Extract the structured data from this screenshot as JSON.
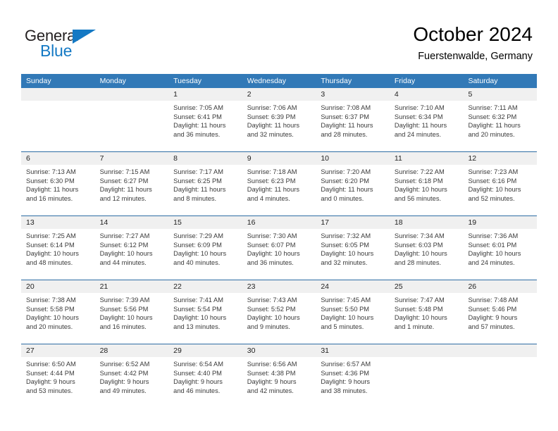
{
  "brand": {
    "name_primary": "General",
    "name_secondary": "Blue",
    "primary_color": "#231f20",
    "accent_color": "#1479c4"
  },
  "header": {
    "title": "October 2024",
    "subtitle": "Fuerstenwalde, Germany"
  },
  "theme": {
    "header_bar_color": "#3279b7",
    "week_divider_color": "#2e6da4",
    "day_band_color": "#f0f0f0",
    "text_color": "#3a3a3a"
  },
  "weekdays": [
    "Sunday",
    "Monday",
    "Tuesday",
    "Wednesday",
    "Thursday",
    "Friday",
    "Saturday"
  ],
  "weeks": [
    [
      {
        "day": "",
        "lines": []
      },
      {
        "day": "",
        "lines": []
      },
      {
        "day": "1",
        "lines": [
          "Sunrise: 7:05 AM",
          "Sunset: 6:41 PM",
          "Daylight: 11 hours",
          "and 36 minutes."
        ]
      },
      {
        "day": "2",
        "lines": [
          "Sunrise: 7:06 AM",
          "Sunset: 6:39 PM",
          "Daylight: 11 hours",
          "and 32 minutes."
        ]
      },
      {
        "day": "3",
        "lines": [
          "Sunrise: 7:08 AM",
          "Sunset: 6:37 PM",
          "Daylight: 11 hours",
          "and 28 minutes."
        ]
      },
      {
        "day": "4",
        "lines": [
          "Sunrise: 7:10 AM",
          "Sunset: 6:34 PM",
          "Daylight: 11 hours",
          "and 24 minutes."
        ]
      },
      {
        "day": "5",
        "lines": [
          "Sunrise: 7:11 AM",
          "Sunset: 6:32 PM",
          "Daylight: 11 hours",
          "and 20 minutes."
        ]
      }
    ],
    [
      {
        "day": "6",
        "lines": [
          "Sunrise: 7:13 AM",
          "Sunset: 6:30 PM",
          "Daylight: 11 hours",
          "and 16 minutes."
        ]
      },
      {
        "day": "7",
        "lines": [
          "Sunrise: 7:15 AM",
          "Sunset: 6:27 PM",
          "Daylight: 11 hours",
          "and 12 minutes."
        ]
      },
      {
        "day": "8",
        "lines": [
          "Sunrise: 7:17 AM",
          "Sunset: 6:25 PM",
          "Daylight: 11 hours",
          "and 8 minutes."
        ]
      },
      {
        "day": "9",
        "lines": [
          "Sunrise: 7:18 AM",
          "Sunset: 6:23 PM",
          "Daylight: 11 hours",
          "and 4 minutes."
        ]
      },
      {
        "day": "10",
        "lines": [
          "Sunrise: 7:20 AM",
          "Sunset: 6:20 PM",
          "Daylight: 11 hours",
          "and 0 minutes."
        ]
      },
      {
        "day": "11",
        "lines": [
          "Sunrise: 7:22 AM",
          "Sunset: 6:18 PM",
          "Daylight: 10 hours",
          "and 56 minutes."
        ]
      },
      {
        "day": "12",
        "lines": [
          "Sunrise: 7:23 AM",
          "Sunset: 6:16 PM",
          "Daylight: 10 hours",
          "and 52 minutes."
        ]
      }
    ],
    [
      {
        "day": "13",
        "lines": [
          "Sunrise: 7:25 AM",
          "Sunset: 6:14 PM",
          "Daylight: 10 hours",
          "and 48 minutes."
        ]
      },
      {
        "day": "14",
        "lines": [
          "Sunrise: 7:27 AM",
          "Sunset: 6:12 PM",
          "Daylight: 10 hours",
          "and 44 minutes."
        ]
      },
      {
        "day": "15",
        "lines": [
          "Sunrise: 7:29 AM",
          "Sunset: 6:09 PM",
          "Daylight: 10 hours",
          "and 40 minutes."
        ]
      },
      {
        "day": "16",
        "lines": [
          "Sunrise: 7:30 AM",
          "Sunset: 6:07 PM",
          "Daylight: 10 hours",
          "and 36 minutes."
        ]
      },
      {
        "day": "17",
        "lines": [
          "Sunrise: 7:32 AM",
          "Sunset: 6:05 PM",
          "Daylight: 10 hours",
          "and 32 minutes."
        ]
      },
      {
        "day": "18",
        "lines": [
          "Sunrise: 7:34 AM",
          "Sunset: 6:03 PM",
          "Daylight: 10 hours",
          "and 28 minutes."
        ]
      },
      {
        "day": "19",
        "lines": [
          "Sunrise: 7:36 AM",
          "Sunset: 6:01 PM",
          "Daylight: 10 hours",
          "and 24 minutes."
        ]
      }
    ],
    [
      {
        "day": "20",
        "lines": [
          "Sunrise: 7:38 AM",
          "Sunset: 5:58 PM",
          "Daylight: 10 hours",
          "and 20 minutes."
        ]
      },
      {
        "day": "21",
        "lines": [
          "Sunrise: 7:39 AM",
          "Sunset: 5:56 PM",
          "Daylight: 10 hours",
          "and 16 minutes."
        ]
      },
      {
        "day": "22",
        "lines": [
          "Sunrise: 7:41 AM",
          "Sunset: 5:54 PM",
          "Daylight: 10 hours",
          "and 13 minutes."
        ]
      },
      {
        "day": "23",
        "lines": [
          "Sunrise: 7:43 AM",
          "Sunset: 5:52 PM",
          "Daylight: 10 hours",
          "and 9 minutes."
        ]
      },
      {
        "day": "24",
        "lines": [
          "Sunrise: 7:45 AM",
          "Sunset: 5:50 PM",
          "Daylight: 10 hours",
          "and 5 minutes."
        ]
      },
      {
        "day": "25",
        "lines": [
          "Sunrise: 7:47 AM",
          "Sunset: 5:48 PM",
          "Daylight: 10 hours",
          "and 1 minute."
        ]
      },
      {
        "day": "26",
        "lines": [
          "Sunrise: 7:48 AM",
          "Sunset: 5:46 PM",
          "Daylight: 9 hours",
          "and 57 minutes."
        ]
      }
    ],
    [
      {
        "day": "27",
        "lines": [
          "Sunrise: 6:50 AM",
          "Sunset: 4:44 PM",
          "Daylight: 9 hours",
          "and 53 minutes."
        ]
      },
      {
        "day": "28",
        "lines": [
          "Sunrise: 6:52 AM",
          "Sunset: 4:42 PM",
          "Daylight: 9 hours",
          "and 49 minutes."
        ]
      },
      {
        "day": "29",
        "lines": [
          "Sunrise: 6:54 AM",
          "Sunset: 4:40 PM",
          "Daylight: 9 hours",
          "and 46 minutes."
        ]
      },
      {
        "day": "30",
        "lines": [
          "Sunrise: 6:56 AM",
          "Sunset: 4:38 PM",
          "Daylight: 9 hours",
          "and 42 minutes."
        ]
      },
      {
        "day": "31",
        "lines": [
          "Sunrise: 6:57 AM",
          "Sunset: 4:36 PM",
          "Daylight: 9 hours",
          "and 38 minutes."
        ]
      },
      {
        "day": "",
        "lines": []
      },
      {
        "day": "",
        "lines": []
      }
    ]
  ]
}
